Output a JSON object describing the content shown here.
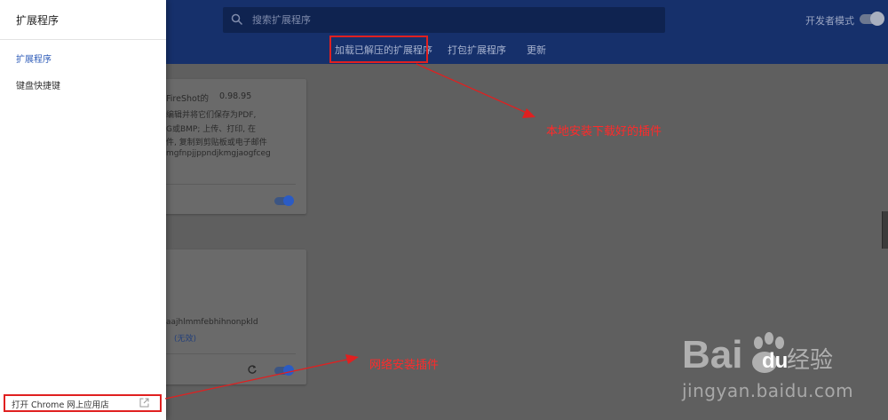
{
  "drawer": {
    "title": "扩展程序",
    "items": [
      {
        "label": "扩展程序",
        "active": true
      },
      {
        "label": "键盘快捷键",
        "active": false
      }
    ],
    "store_link": "打开 Chrome 网上应用店"
  },
  "toolbar": {
    "search_placeholder": "搜索扩展程序",
    "devmode_label": "开发者模式",
    "devmode_on": false
  },
  "subtabs": [
    {
      "label": "加载已解压的扩展程序"
    },
    {
      "label": "打包扩展程序"
    },
    {
      "label": "更新"
    }
  ],
  "cards": [
    {
      "name": "FireShot的",
      "version": "0.98.95",
      "desc_lines": [
        "编辑并将它们保存为PDF,",
        "G或BMP; 上传、打印, 在",
        "件, 复制到剪贴板或电子邮件"
      ],
      "id": "mgfnpjjppndjkmgjaogfceg",
      "enabled": true
    },
    {
      "id": "aajhlmmfebhihnonpkld",
      "status": "(无效)",
      "enabled": true
    }
  ],
  "annotations": {
    "local_install": "本地安装下载好的插件",
    "web_install": "网络安装插件"
  },
  "watermark": {
    "url": "jingyan.baidu.com"
  },
  "colors": {
    "header": "#16306b",
    "accent": "#1a73e8",
    "annotation": "#ff2a2a"
  }
}
